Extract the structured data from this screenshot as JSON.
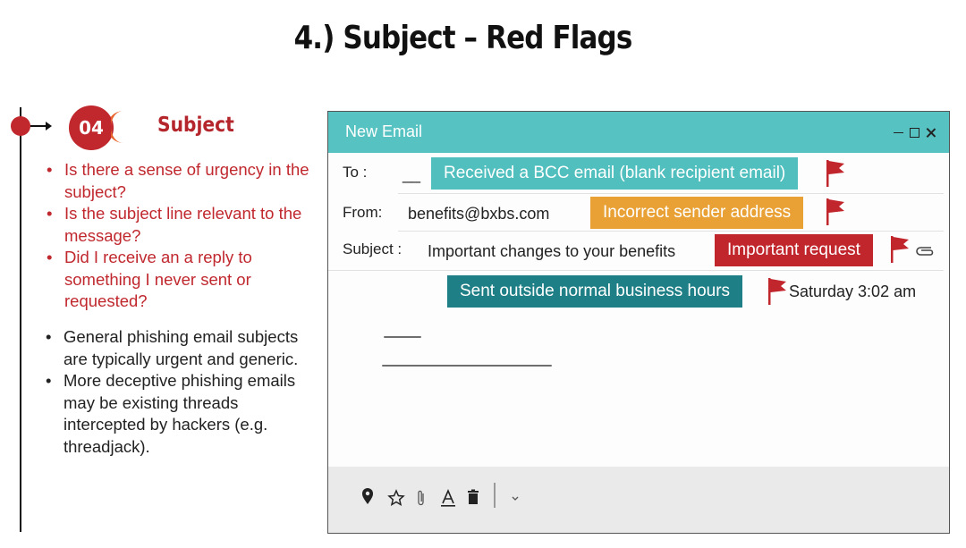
{
  "title": "4.) Subject – Red Flags",
  "step": {
    "number": "04",
    "label": "Subject"
  },
  "red_questions": [
    "Is there a sense of urgency in the subject?",
    "Is the subject line relevant to the message?",
    "Did I receive an a reply to something I never sent or requested?"
  ],
  "notes": [
    "General phishing email subjects are typically urgent and generic.",
    "More deceptive phishing emails may be existing threads intercepted by hackers (e.g. threadjack)."
  ],
  "email": {
    "window_title": "New Email",
    "to_label": "To :",
    "to_value": "__",
    "from_label": "From:",
    "from_value": "benefits@bxbs.com",
    "subject_label": "Subject :",
    "subject_value": "Important changes to your benefits",
    "timestamp": "Saturday 3:02 am"
  },
  "flags": {
    "bcc": "Received a BCC email (blank recipient email)",
    "sender": "Incorrect sender address",
    "request": "Important request",
    "hours": "Sent outside normal business hours"
  },
  "colors": {
    "accent_red": "#c0282e",
    "header_teal": "#56c3c2",
    "tag_teal": "#52bfbf",
    "tag_orange": "#e9a135",
    "tag_red": "#c1262d",
    "tag_darkteal": "#1f7f86"
  },
  "toolbar_icons": [
    "location-pin-icon",
    "star-icon",
    "paperclip-icon",
    "text-format-icon",
    "trash-icon",
    "chevron-down-icon"
  ]
}
